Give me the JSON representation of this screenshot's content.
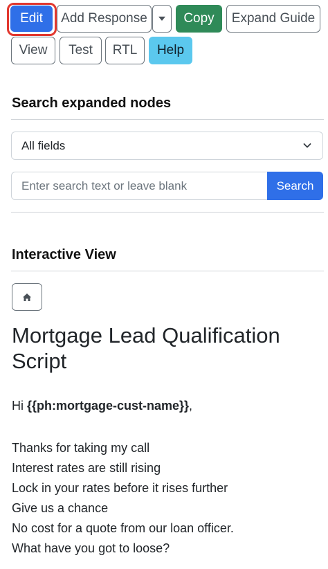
{
  "toolbar": {
    "edit_label": "Edit",
    "add_response_label": "Add Response",
    "copy_label": "Copy",
    "expand_guide_label": "Expand Guide",
    "view_label": "View",
    "test_label": "Test",
    "rtl_label": "RTL",
    "help_label": "Help"
  },
  "search_section": {
    "heading": "Search expanded nodes",
    "field_select": {
      "selected": "All fields"
    },
    "search_input": {
      "value": "",
      "placeholder": "Enter search text or leave blank"
    },
    "search_button_label": "Search"
  },
  "interactive_view": {
    "heading": "Interactive View",
    "home_icon": "home-icon",
    "script_title": "Mortgage Lead Qualification Script",
    "greeting_prefix": "Hi ",
    "greeting_placeholder": "{{ph:mortgage-cust-name}}",
    "greeting_suffix": ",",
    "lines": [
      "Thanks for taking my call",
      "Interest rates are still rising",
      "Lock in your rates before it rises further",
      "Give us a chance",
      "No cost for a quote from our loan officer.",
      "What have you got to loose?"
    ]
  },
  "colors": {
    "primary": "#2f6fe8",
    "success": "#2f8a58",
    "info": "#5bc8ee",
    "highlight": "#e2382f"
  }
}
